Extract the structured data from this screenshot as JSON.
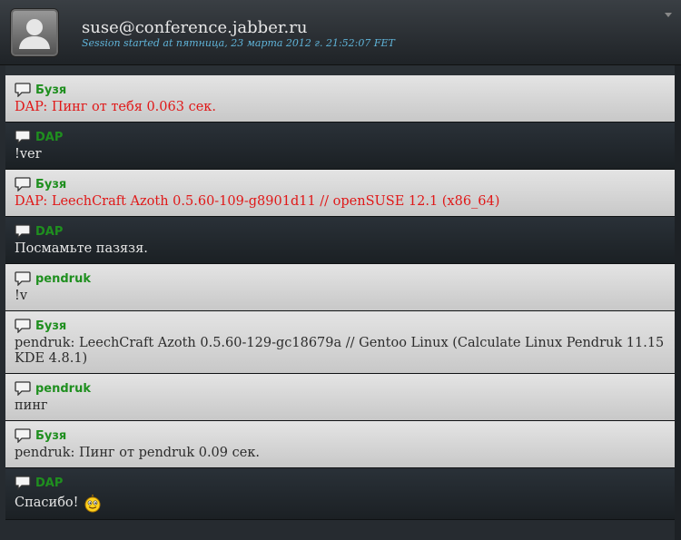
{
  "header": {
    "room": "suse@conference.jabber.ru",
    "session": "Session started at пятница, 23 марта 2012 г. 21:52:07 FET"
  },
  "icons": {
    "avatar": "user-silhouette-icon",
    "message": "speech-bubble-icon",
    "smiley": "smiley-icon",
    "menu": "chevron-down-icon"
  },
  "colors": {
    "nick": "#1f8f1f",
    "highlight_text": "#e01818",
    "session_text": "#5fb3d8"
  },
  "messages": [
    {
      "nick": "Бузя",
      "text": "DAP: Пинг от тебя 0.063 сек.",
      "style": "light",
      "highlight": true
    },
    {
      "nick": "DAP",
      "text": "!ver",
      "style": "dark",
      "highlight": false
    },
    {
      "nick": "Бузя",
      "text": "DAP: LeechCraft Azoth 0.5.60-109-g8901d11 // openSUSE 12.1 (x86_64)",
      "style": "light",
      "highlight": true
    },
    {
      "nick": "DAP",
      "text": "Посмамьте пазязя.",
      "style": "dark",
      "highlight": false
    },
    {
      "nick": "pendruk",
      "text": "!v",
      "style": "light",
      "highlight": false
    },
    {
      "nick": "Бузя",
      "text": "pendruk: LeechCraft Azoth 0.5.60-129-gc18679a // Gentoo Linux (Calculate Linux Pendruk 11.15 KDE 4.8.1)",
      "style": "light",
      "highlight": false
    },
    {
      "nick": "pendruk",
      "text": "пинг",
      "style": "light",
      "highlight": false
    },
    {
      "nick": "Бузя",
      "text": "pendruk: Пинг от pendruk 0.09 сек.",
      "style": "light",
      "highlight": false
    },
    {
      "nick": "DAP",
      "text": "Спасибо!",
      "style": "dark",
      "highlight": false,
      "smiley": true
    }
  ]
}
